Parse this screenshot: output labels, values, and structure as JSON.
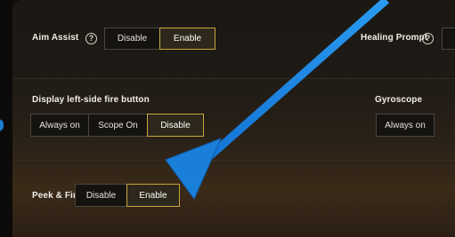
{
  "settings": {
    "aim_assist": {
      "label": "Aim Assist",
      "options": [
        "Disable",
        "Enable"
      ],
      "selected": "Enable"
    },
    "healing_prompt": {
      "label": "Healing Prompt"
    },
    "fire_button": {
      "label": "Display left-side fire button",
      "options": [
        "Always on",
        "Scope On",
        "Disable"
      ],
      "selected": "Disable"
    },
    "gyroscope": {
      "label": "Gyroscope",
      "options": [
        "Always on"
      ]
    },
    "peek_fire": {
      "label": "Peek & Fire",
      "options": [
        "Disable",
        "Enable"
      ],
      "selected": "Enable"
    }
  },
  "help_glyph": "?",
  "icons": [
    "help-icon",
    "annotation-arrow"
  ],
  "colors": {
    "selected_border": "#c9a540",
    "arrow": "#1e8ae6"
  }
}
